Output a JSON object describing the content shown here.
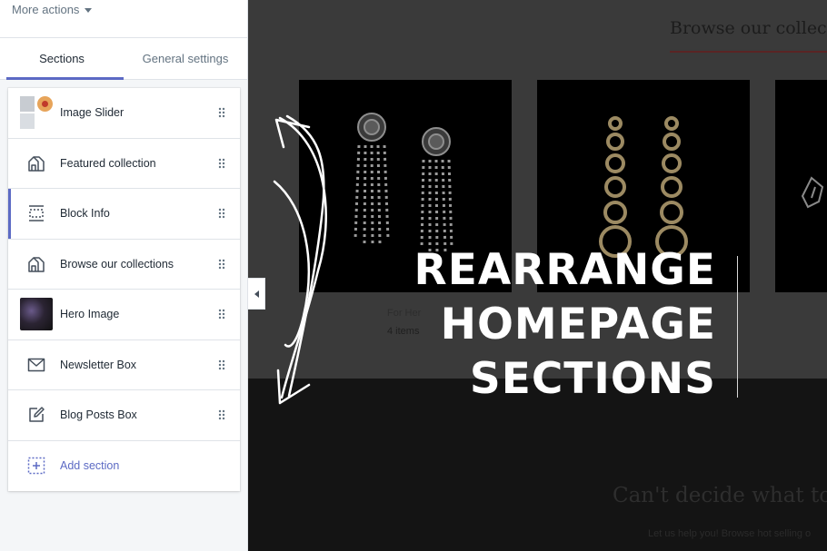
{
  "topbar": {
    "more_actions_label": "More actions"
  },
  "tabs": [
    {
      "label": "Sections",
      "active": true
    },
    {
      "label": "General settings",
      "active": false
    }
  ],
  "sections": [
    {
      "label": "Image Slider",
      "icon": "image-slider-thumbnail"
    },
    {
      "label": "Featured collection",
      "icon": "collection-icon"
    },
    {
      "label": "Block Info",
      "icon": "block-info-icon",
      "selected": true
    },
    {
      "label": "Browse our collections",
      "icon": "collection-icon"
    },
    {
      "label": "Hero Image",
      "icon": "hero-image-thumbnail"
    },
    {
      "label": "Newsletter Box",
      "icon": "envelope-icon"
    },
    {
      "label": "Blog Posts Box",
      "icon": "edit-icon"
    }
  ],
  "add_section_label": "Add section",
  "preview": {
    "collections_heading": "Browse our collecti",
    "product_caption": "For Her",
    "product_count": "4 items",
    "overlay_title": [
      "REARRANGE",
      "HOMEPAGE",
      "SECTIONS"
    ],
    "cta_heading": "Can't decide what to",
    "cta_text": "Let us help you! Browse hot selling o"
  },
  "colors": {
    "accent": "#5c6ac4",
    "text_primary": "#212b36",
    "text_muted": "#637381",
    "preview_top_bg": "#3a3a3a",
    "preview_bottom_bg": "#141414"
  }
}
